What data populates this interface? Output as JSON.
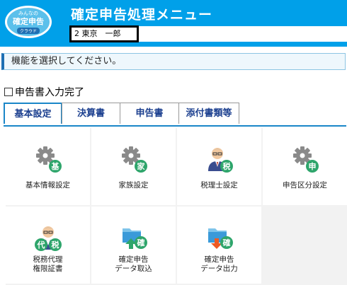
{
  "header": {
    "logo_line1": "みんなの",
    "logo_line2": "確定申告",
    "logo_line3": "クラウド",
    "title": "確定申告処理メニュー",
    "user_label": "2 東京　一郎"
  },
  "instruction": "機能を選択してください。",
  "completion_checkbox": {
    "label": "申告書入力完了",
    "checked": false
  },
  "tabs": [
    {
      "label": "基本設定",
      "active": true
    },
    {
      "label": "決算書",
      "active": false
    },
    {
      "label": "申告書",
      "active": false
    },
    {
      "label": "添付書類等",
      "active": false
    }
  ],
  "tiles": [
    {
      "label": "基本情報設定",
      "badge": "基",
      "icon": "gear-icon"
    },
    {
      "label": "家族設定",
      "badge": "家",
      "icon": "gear-icon"
    },
    {
      "label": "税理士設定",
      "badge": "税",
      "icon": "person-icon"
    },
    {
      "label": "申告区分設定",
      "badge": "申",
      "icon": "gear-icon"
    },
    {
      "label_line1": "税務代理",
      "label_line2": "権限証書",
      "badge1": "代",
      "badge2": "税",
      "icon": "person-icon"
    },
    {
      "label_line1": "確定申告",
      "label_line2": "データ取込",
      "badge": "確",
      "icon": "folder-import-icon"
    },
    {
      "label_line1": "確定申告",
      "label_line2": "データ出力",
      "badge": "確",
      "icon": "folder-export-icon"
    }
  ],
  "colors": {
    "header_bg": "#00a0e9",
    "accent": "#1a86c8",
    "badge_green": "#2ea56b",
    "import_arrow": "#2ea56b",
    "export_arrow": "#ee5a24"
  }
}
